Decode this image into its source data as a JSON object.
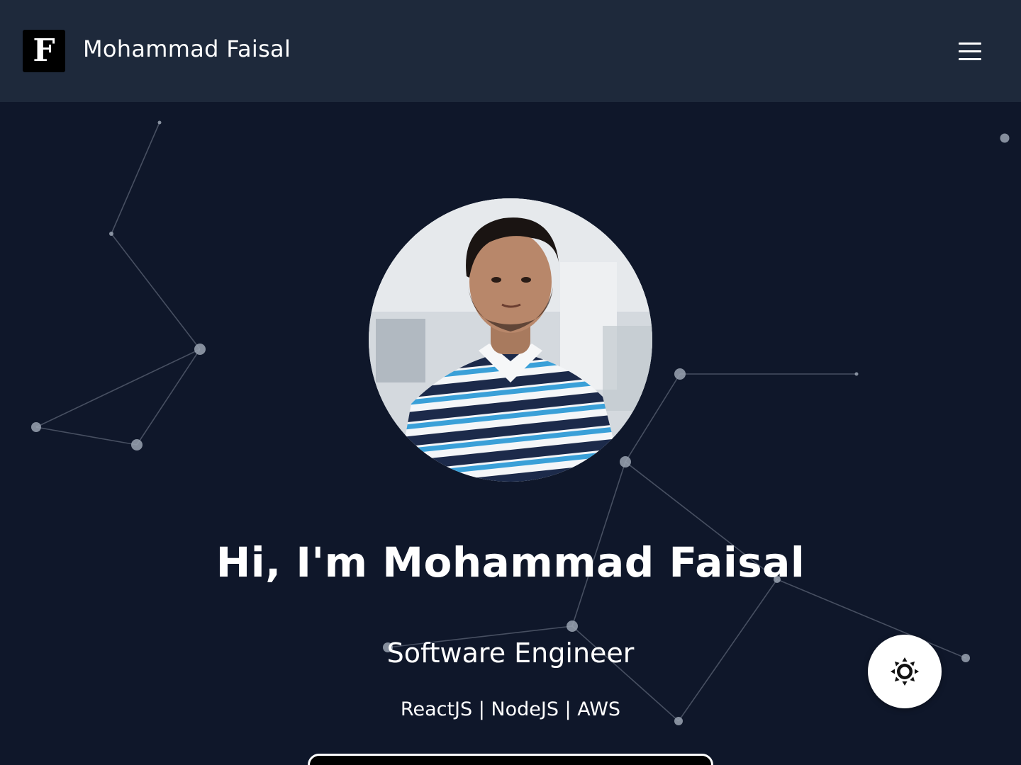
{
  "header": {
    "logo_letter": "F",
    "brand_name": "Mohammad Faisal",
    "menu_icon": "hamburger-menu-icon"
  },
  "hero": {
    "avatar_alt": "Mohammad Faisal",
    "title": "Hi, I'm Mohammad Faisal",
    "subtitle": "Software Engineer",
    "tagline": "ReactJS | NodeJS | AWS",
    "cta_label": ""
  },
  "floating": {
    "theme_toggle_icon": "sun-icon"
  },
  "colors": {
    "page_background": "#0f172a",
    "navbar_background": "#1e293b",
    "text": "#ffffff",
    "particle": "#94a3b8"
  }
}
